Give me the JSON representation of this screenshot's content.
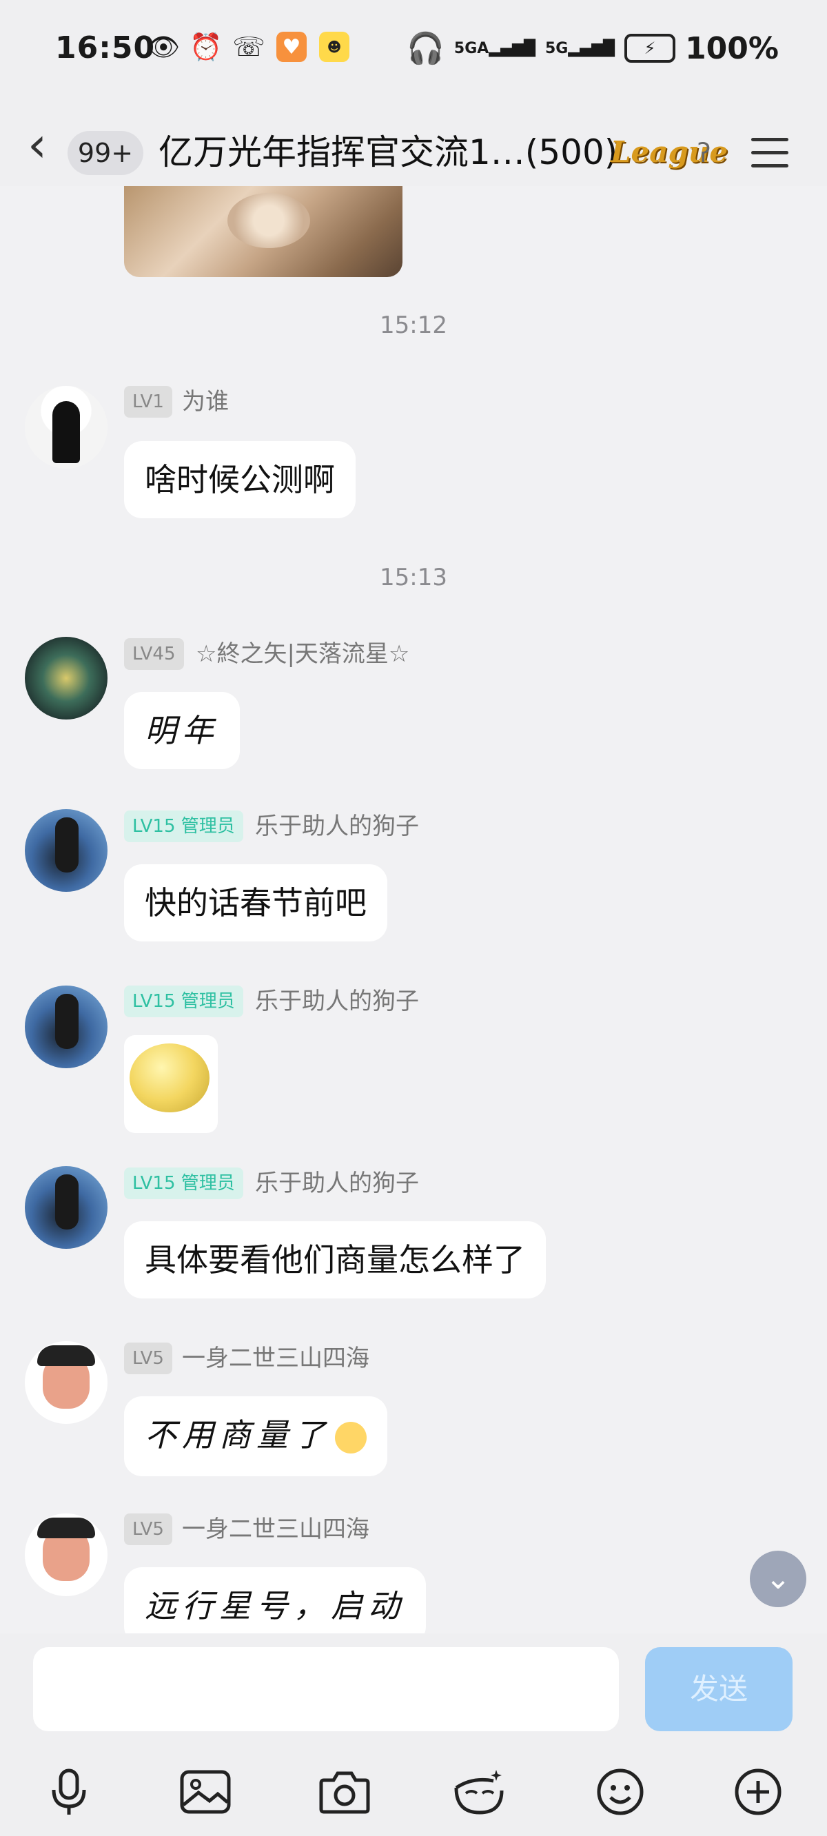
{
  "status_bar": {
    "time": "16:50",
    "signal_1": "5GA",
    "signal_2": "5G",
    "battery": "100%"
  },
  "header": {
    "unread_count": "99+",
    "title": "亿万光年指挥官交流1…(500)",
    "league_badge": "League"
  },
  "messages": [
    {
      "type": "timestamp",
      "text": "15:12"
    },
    {
      "level": "LV1",
      "nickname": "为谁",
      "text": "啥时候公测啊"
    },
    {
      "type": "timestamp",
      "text": "15:13"
    },
    {
      "level": "LV45",
      "nickname": "☆終之矢|天落流星☆",
      "text": "明年"
    },
    {
      "level": "LV15 管理员",
      "nickname": "乐于助人的狗子",
      "text": "快的话春节前吧"
    },
    {
      "level": "LV15 管理员",
      "nickname": "乐于助人的狗子",
      "sticker": "smiley-sticker"
    },
    {
      "level": "LV15 管理员",
      "nickname": "乐于助人的狗子",
      "text": "具体要看他们商量怎么样了"
    },
    {
      "level": "LV5",
      "nickname": "一身二世三山四海",
      "text": "不用商量了"
    },
    {
      "level": "LV5",
      "nickname": "一身二世三山四海",
      "text": "远行星号，启动"
    }
  ],
  "input": {
    "placeholder": "",
    "send_label": "发送"
  },
  "colors": {
    "send_button": "#9fcdf6",
    "admin_badge_text": "#2ec0a2",
    "admin_badge_bg": "#d8f2ec"
  }
}
